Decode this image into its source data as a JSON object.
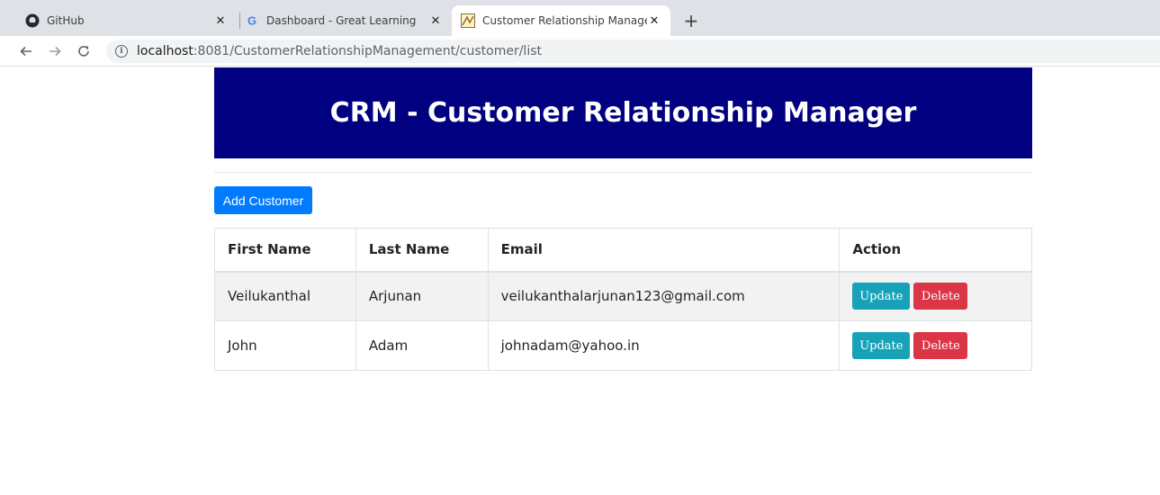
{
  "browser": {
    "tabs": [
      {
        "title": "GitHub",
        "icon": "github-icon",
        "active": false
      },
      {
        "title": "Dashboard - Great Learning",
        "icon": "google-icon",
        "active": false
      },
      {
        "title": "Customer Relationship Managem",
        "icon": "crm-favicon",
        "active": true
      }
    ],
    "close_glyph": "✕",
    "new_tab_glyph": "+",
    "url_host": "localhost",
    "url_rest": ":8081/CustomerRelationshipManagement/customer/list"
  },
  "page": {
    "header": "CRM - Customer Relationship Manager",
    "add_button": "Add Customer",
    "columns": [
      "First Name",
      "Last Name",
      "Email",
      "Action"
    ],
    "rows": [
      {
        "first_name": "Veilukanthal",
        "last_name": "Arjunan",
        "email": "veilukanthalarjunan123@gmail.com",
        "update": "Update",
        "delete": "Delete"
      },
      {
        "first_name": "John",
        "last_name": "Adam",
        "email": "johnadam@yahoo.in",
        "update": "Update",
        "delete": "Delete"
      }
    ]
  },
  "colors": {
    "header_bg": "#000080",
    "primary": "#007bff",
    "info": "#17a2b8",
    "danger": "#dc3545"
  }
}
